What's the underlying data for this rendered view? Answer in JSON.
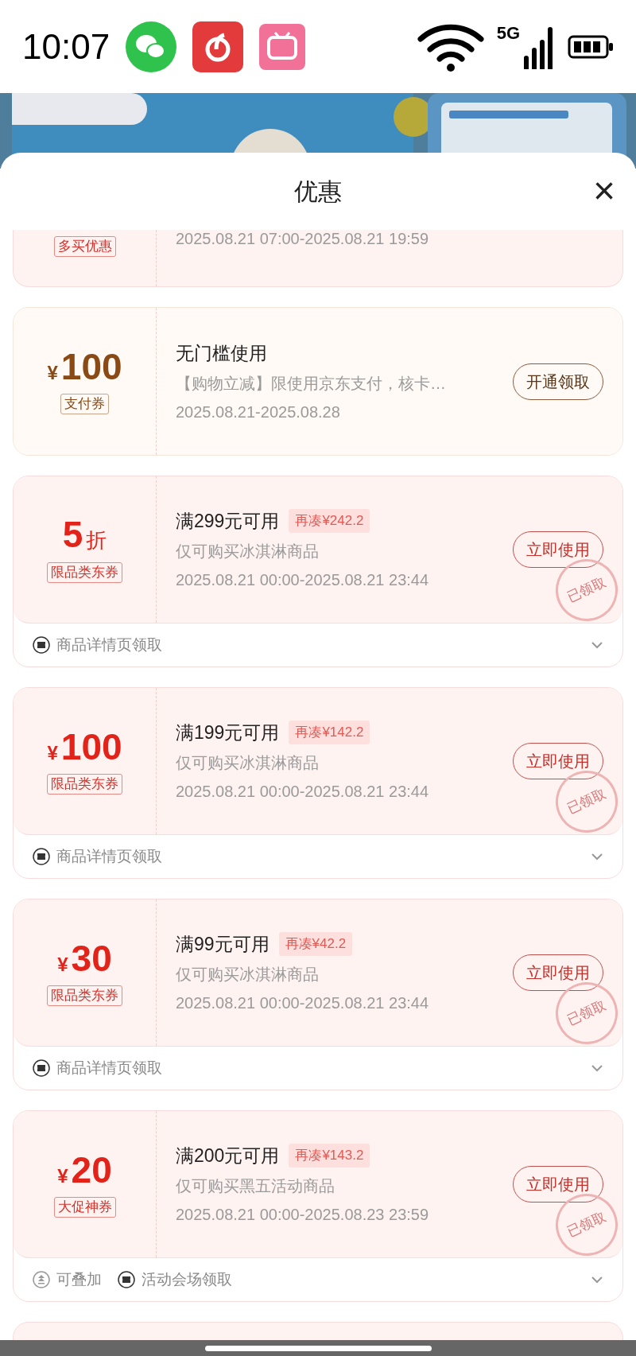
{
  "status_bar": {
    "time": "10:07",
    "network": "5G"
  },
  "sheet": {
    "title": "优惠",
    "close": "×"
  },
  "partial_coupon": {
    "tag": "多买优惠",
    "date": "2025.08.21 07:00-2025.08.21 19:59"
  },
  "coupons": [
    {
      "kind": "pay",
      "currency": "¥",
      "amount": "100",
      "tag": "支付券",
      "title": "无门槛使用",
      "desc": "【购物立减】限使用京东支付，核卡…",
      "date": "2025.08.21-2025.08.28",
      "button": "开通领取",
      "claimed": false
    },
    {
      "kind": "category",
      "amount": "5",
      "unit": "折",
      "tag": "限品类东券",
      "title": "满299元可用",
      "extra": "再凑¥242.2",
      "desc": "仅可购买冰淇淋商品",
      "date": "2025.08.21 00:00-2025.08.21 23:44",
      "button": "立即使用",
      "claimed": true,
      "stamp": "已领取",
      "footer": [
        {
          "kind": "ticket",
          "text": "商品详情页领取"
        }
      ]
    },
    {
      "kind": "category",
      "currency": "¥",
      "amount": "100",
      "tag": "限品类东券",
      "title": "满199元可用",
      "extra": "再凑¥142.2",
      "desc": "仅可购买冰淇淋商品",
      "date": "2025.08.21 00:00-2025.08.21 23:44",
      "button": "立即使用",
      "claimed": true,
      "stamp": "已领取",
      "footer": [
        {
          "kind": "ticket",
          "text": "商品详情页领取"
        }
      ]
    },
    {
      "kind": "category",
      "currency": "¥",
      "amount": "30",
      "tag": "限品类东券",
      "title": "满99元可用",
      "extra": "再凑¥42.2",
      "desc": "仅可购买冰淇淋商品",
      "date": "2025.08.21 00:00-2025.08.21 23:44",
      "button": "立即使用",
      "claimed": true,
      "stamp": "已领取",
      "footer": [
        {
          "kind": "ticket",
          "text": "商品详情页领取"
        }
      ]
    },
    {
      "kind": "category",
      "currency": "¥",
      "amount": "20",
      "tag": "大促神券",
      "title": "满200元可用",
      "extra": "再凑¥143.2",
      "desc": "仅可购买黑五活动商品",
      "date": "2025.08.21 00:00-2025.08.23 23:59",
      "button": "立即使用",
      "claimed": true,
      "stamp": "已领取",
      "footer": [
        {
          "kind": "stack",
          "text": "可叠加"
        },
        {
          "kind": "ticket",
          "text": "活动会场领取"
        }
      ]
    }
  ]
}
